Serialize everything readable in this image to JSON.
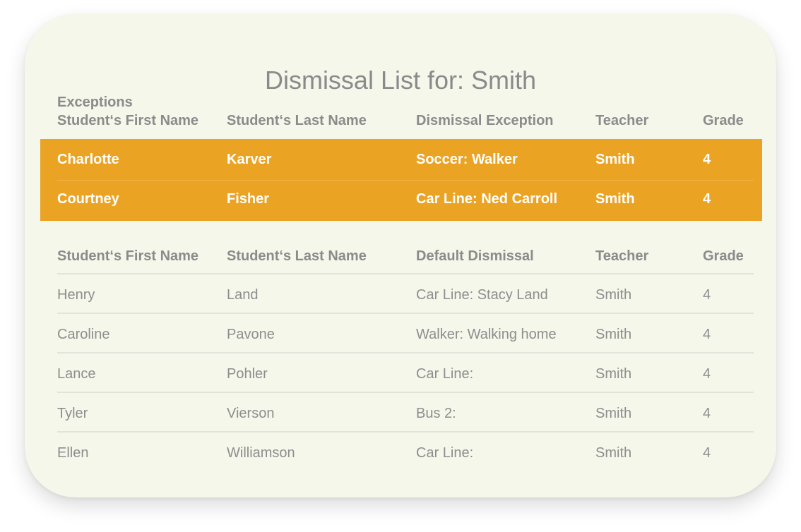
{
  "title": "Dismissal List for: Smith",
  "exceptions": {
    "label": "Exceptions",
    "headers": [
      "Student‘s First Name",
      "Student‘s Last Name",
      "Dismissal Exception",
      "Teacher",
      "Grade"
    ],
    "rows": [
      [
        "Charlotte",
        "Karver",
        "Soccer: Walker",
        "Smith",
        "4"
      ],
      [
        "Courtney",
        "Fisher",
        "Car Line: Ned Carroll",
        "Smith",
        "4"
      ]
    ],
    "highlight_color": "#eba324"
  },
  "defaults": {
    "headers": [
      "Student‘s First Name",
      "Student‘s Last Name",
      "Default Dismissal",
      "Teacher",
      "Grade"
    ],
    "rows": [
      [
        "Henry",
        "Land",
        "Car Line: Stacy Land",
        "Smith",
        "4"
      ],
      [
        "Caroline",
        "Pavone",
        "Walker: Walking home",
        "Smith",
        "4"
      ],
      [
        "Lance",
        "Pohler",
        "Car Line:",
        "Smith",
        "4"
      ],
      [
        "Tyler",
        "Vierson",
        "Bus 2:",
        "Smith",
        "4"
      ],
      [
        "Ellen",
        "Williamson",
        "Car Line:",
        "Smith",
        "4"
      ]
    ]
  }
}
